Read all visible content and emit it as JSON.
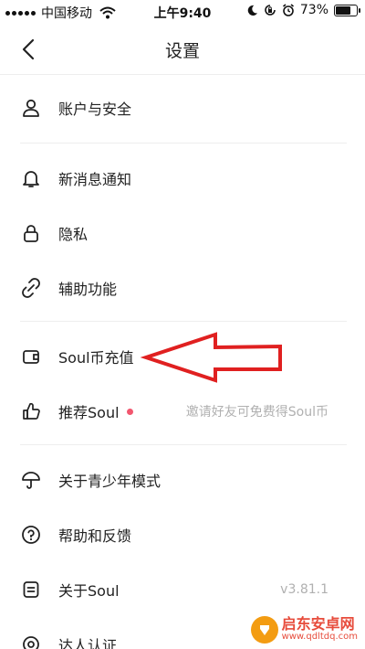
{
  "status_bar": {
    "carrier": "中国移动",
    "time": "上午9:40",
    "battery_text": "73%",
    "battery_level": 0.73,
    "icons": [
      "signal-icon",
      "wifi-icon",
      "moon-icon",
      "rotation-lock-icon",
      "alarm-icon",
      "battery-icon"
    ]
  },
  "nav": {
    "title": "设置",
    "back_icon": "chevron-left-icon"
  },
  "menu": {
    "items": [
      {
        "label": "账户与安全",
        "icon": "user-icon"
      },
      {
        "label": "新消息通知",
        "icon": "bell-icon"
      },
      {
        "label": "隐私",
        "icon": "lock-icon"
      },
      {
        "label": "辅助功能",
        "icon": "link-icon"
      },
      {
        "label": "Soul币充值",
        "icon": "wallet-icon"
      },
      {
        "label": "推荐Soul",
        "icon": "thumbs-up-icon",
        "extra": "邀请好友可免费得Soul币",
        "badge_color": "#f2566e"
      },
      {
        "label": "关于青少年模式",
        "icon": "umbrella-icon"
      },
      {
        "label": "帮助和反馈",
        "icon": "help-circle-icon"
      },
      {
        "label": "关于Soul",
        "icon": "document-icon",
        "extra": "v3.81.1"
      },
      {
        "label": "达人认证",
        "icon": "badge-icon"
      }
    ]
  },
  "annotation": {
    "arrow_color": "#e02020"
  },
  "watermark": {
    "title": "启东安卓网",
    "url": "www.qdltdq.com"
  }
}
